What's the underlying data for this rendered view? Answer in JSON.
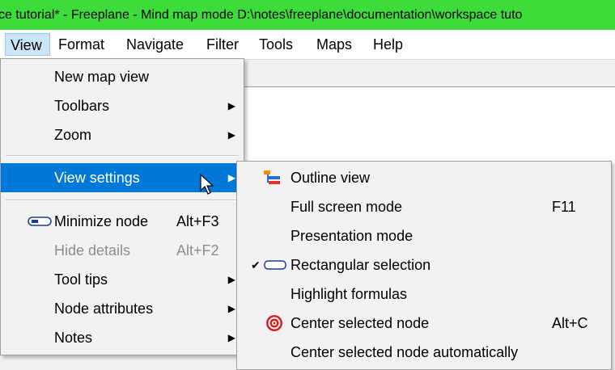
{
  "window": {
    "title": "ce tutorial* - Freeplane - Mind map mode D:\\notes\\freeplane\\documentation\\workspace tuto"
  },
  "menubar": [
    {
      "label": "View"
    },
    {
      "label": "Format"
    },
    {
      "label": "Navigate"
    },
    {
      "label": "Filter"
    },
    {
      "label": "Tools"
    },
    {
      "label": "Maps"
    },
    {
      "label": "Help"
    }
  ],
  "view_menu": {
    "items": [
      {
        "label": "New map view"
      },
      {
        "label": "Toolbars"
      },
      {
        "label": "Zoom"
      },
      {
        "label": "View settings"
      },
      {
        "label": "Minimize node",
        "accelerator": "Alt+F3"
      },
      {
        "label": "Hide details",
        "accelerator": "Alt+F2"
      },
      {
        "label": "Tool tips"
      },
      {
        "label": "Node attributes"
      },
      {
        "label": "Notes"
      }
    ]
  },
  "view_settings_submenu": {
    "items": [
      {
        "label": "Outline view"
      },
      {
        "label": "Full screen mode",
        "accelerator": "F11"
      },
      {
        "label": "Presentation mode"
      },
      {
        "label": "Rectangular selection",
        "checked": true
      },
      {
        "label": "Highlight formulas"
      },
      {
        "label": "Center selected node",
        "accelerator": "Alt+C"
      },
      {
        "label": "Center selected node automatically"
      }
    ]
  },
  "colors": {
    "title_bar": "#3ddc3a",
    "menu_highlight": "#0078d7",
    "menubar_active": "#cce4f7"
  }
}
